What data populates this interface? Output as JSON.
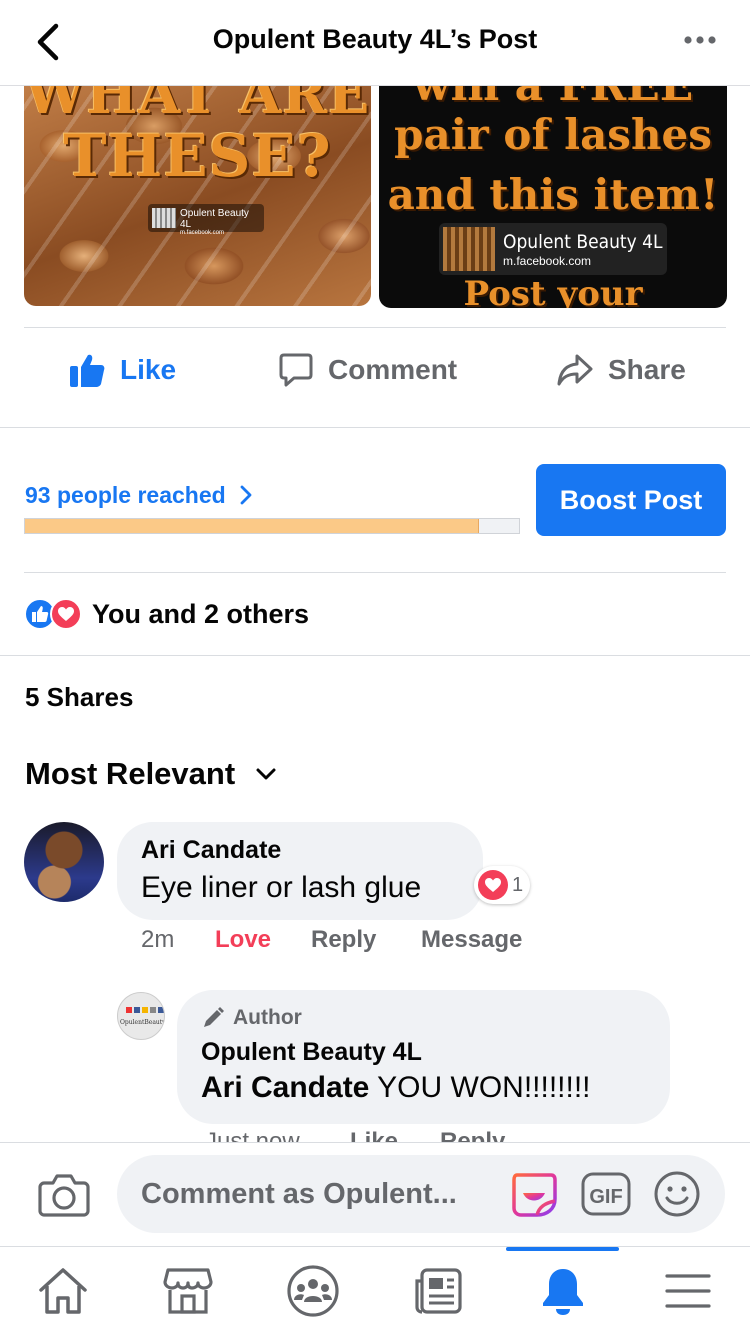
{
  "header": {
    "title": "Opulent Beauty 4L’s Post"
  },
  "post_images": {
    "left": {
      "line1": "WHAT ARE",
      "line2": "THESE?",
      "watermark_name": "Opulent Beauty 4L",
      "watermark_url": "m.facebook.com"
    },
    "right": {
      "line1": "win a FREE",
      "line2": "pair of lashes",
      "line3": "and this item!",
      "watermark_name": "Opulent Beauty 4L",
      "watermark_url": "m.facebook.com",
      "line4": "Post your"
    }
  },
  "actions": {
    "like": "Like",
    "comment": "Comment",
    "share": "Share"
  },
  "reach": {
    "label": "93 people reached",
    "progress_fraction": 0.92,
    "boost_label": "Boost Post"
  },
  "reactions": {
    "summary": "You and 2 others"
  },
  "shares": "5 Shares",
  "sort_label": "Most Relevant",
  "comments": [
    {
      "author": "Ari Candate",
      "text": "Eye liner or lash glue",
      "reaction_count": "1",
      "time": "2m",
      "love": "Love",
      "reply": "Reply",
      "message": "Message"
    }
  ],
  "reply": {
    "badge": "Author",
    "author": "Opulent Beauty 4L",
    "mention": "Ari Candate",
    "text": " YOU WON!!!!!!!!",
    "time": "Just now",
    "like": "Like",
    "reply": "Reply"
  },
  "composer": {
    "placeholder": "Comment as Opulent..."
  },
  "colors": {
    "brand_blue": "#1877f2",
    "love_red": "#f33e58",
    "progress_fill": "#fbc987"
  },
  "nav": [
    "home-icon",
    "marketplace-icon",
    "groups-icon",
    "news-icon",
    "notifications-icon",
    "menu-icon"
  ]
}
